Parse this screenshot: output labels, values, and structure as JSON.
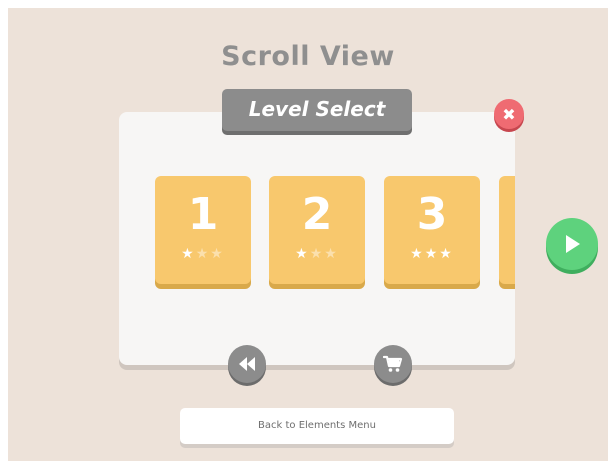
{
  "screen_title": "Scroll View",
  "dialog": {
    "title": "Level Select",
    "close_glyph": "✖"
  },
  "levels": [
    {
      "number": "1",
      "stars": 1,
      "max_stars": 3
    },
    {
      "number": "2",
      "stars": 1,
      "max_stars": 3
    },
    {
      "number": "3",
      "stars": 3,
      "max_stars": 3
    }
  ],
  "icons": {
    "close": "close-icon",
    "rewind": "rewind-icon",
    "cart": "cart-icon",
    "play": "play-icon",
    "star": "star-icon"
  },
  "colors": {
    "background": "#ede2d9",
    "panel": "#f7f6f5",
    "tile": "#f8c86d",
    "header": "#8c8c8c",
    "close": "#ef6b72",
    "play": "#5ed27d"
  },
  "footer": {
    "back_label": "Back to Elements Menu"
  }
}
